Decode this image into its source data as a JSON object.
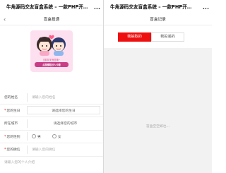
{
  "left": {
    "window_title": "牛角源码交友盲盒系统 – 一款PHP开…",
    "menu_icon": "more-dots-icon",
    "nav_title": "盲盒投递",
    "banner": {
      "caption_top": "当前暂无盲盒哦~",
      "caption_bottom": "点我擦取好人卡哦"
    },
    "form": {
      "name_label": "您的姓名",
      "name_placeholder": "请输入您的姓名",
      "birthday_label": "您的生日",
      "birthday_placeholder": "请选择您的生日",
      "city_label": "所在城市",
      "city_placeholder": "请选择您的城市",
      "gender_label": "您的性别",
      "gender_male": "男",
      "gender_female": "女",
      "wechat_label": "您的微信",
      "wechat_placeholder": "请输入您的微信",
      "intro_placeholder": "请输入您的个人介绍"
    }
  },
  "right": {
    "window_title": "牛角源码交友盲盒系统 – 一款PHP开…",
    "menu_icon": "more-dots-icon",
    "nav_title": "盲盒记录",
    "tabs": [
      {
        "label": "我抽取的",
        "active": true
      },
      {
        "label": "我投递的",
        "active": false
      }
    ],
    "empty_text": "盲盒空空如也...",
    "accent_color": "#ee1010"
  }
}
